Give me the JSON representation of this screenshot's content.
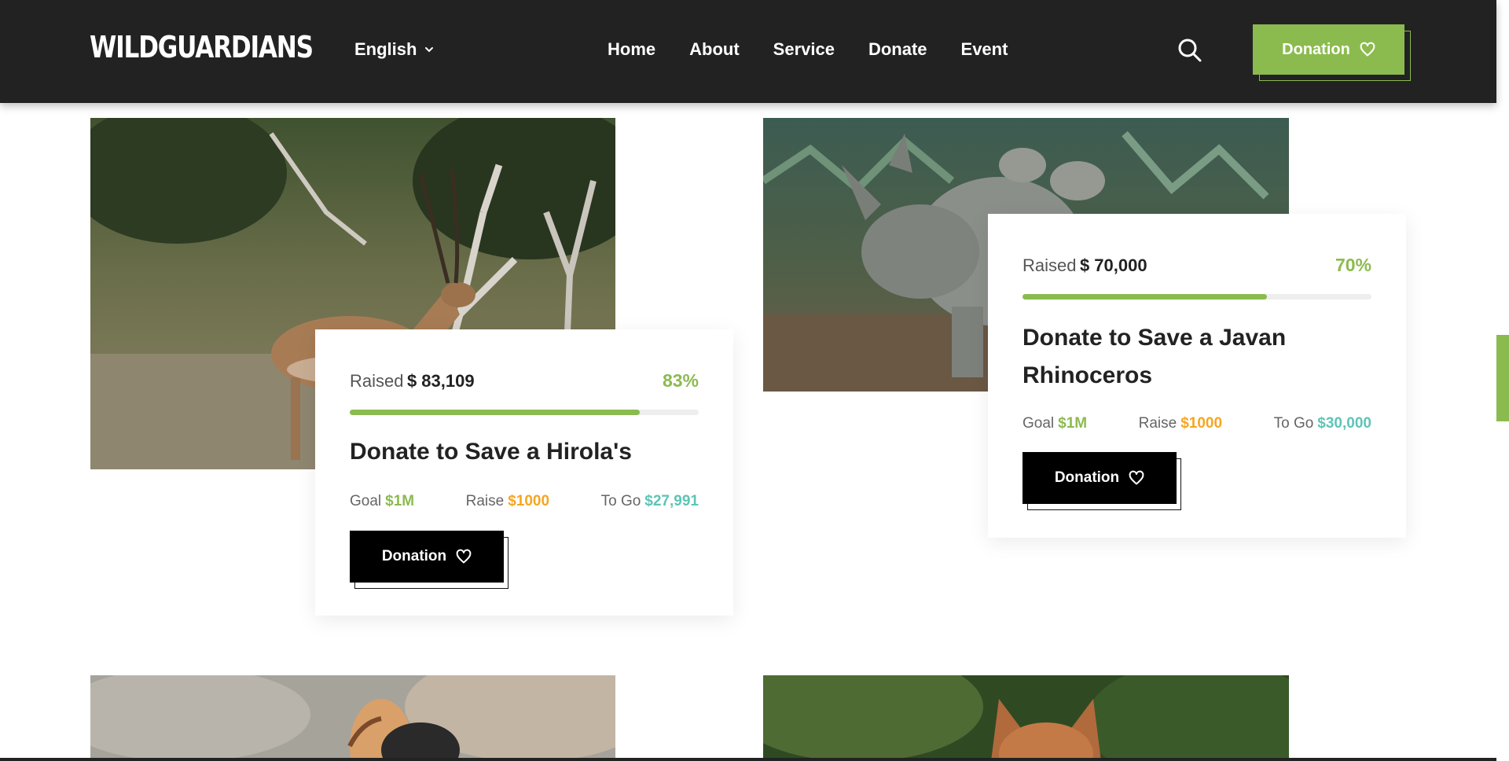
{
  "header": {
    "logo": "WILDGUARDIANS",
    "language": "English",
    "nav": [
      "Home",
      "About",
      "Service",
      "Donate",
      "Event"
    ],
    "donate_label": "Donation"
  },
  "campaigns": [
    {
      "raised_label": "Raised",
      "raised_amount": "$ 83,109",
      "percent": "83%",
      "progress": 0.83,
      "title": "Donate to Save a Hirola's",
      "goal_label": "Goal",
      "goal_value": "$1M",
      "raise_label": "Raise",
      "raise_value": "$1000",
      "togo_label": "To Go",
      "togo_value": "$27,991",
      "button_label": "Donation"
    },
    {
      "raised_label": "Raised",
      "raised_amount": "$ 70,000",
      "percent": "70%",
      "progress": 0.7,
      "title": "Donate to Save a Javan Rhinoceros",
      "goal_label": "Goal",
      "goal_value": "$1M",
      "raise_label": "Raise",
      "raise_value": "$1000",
      "togo_label": "To Go",
      "togo_value": "$30,000",
      "button_label": "Donation"
    }
  ],
  "colors": {
    "header_bg": "#222222",
    "accent_green": "#8bbb4f",
    "orange": "#f5a623",
    "teal": "#5ec4b6"
  },
  "icons": [
    "chevron-down-icon",
    "search-icon",
    "heart-icon"
  ]
}
